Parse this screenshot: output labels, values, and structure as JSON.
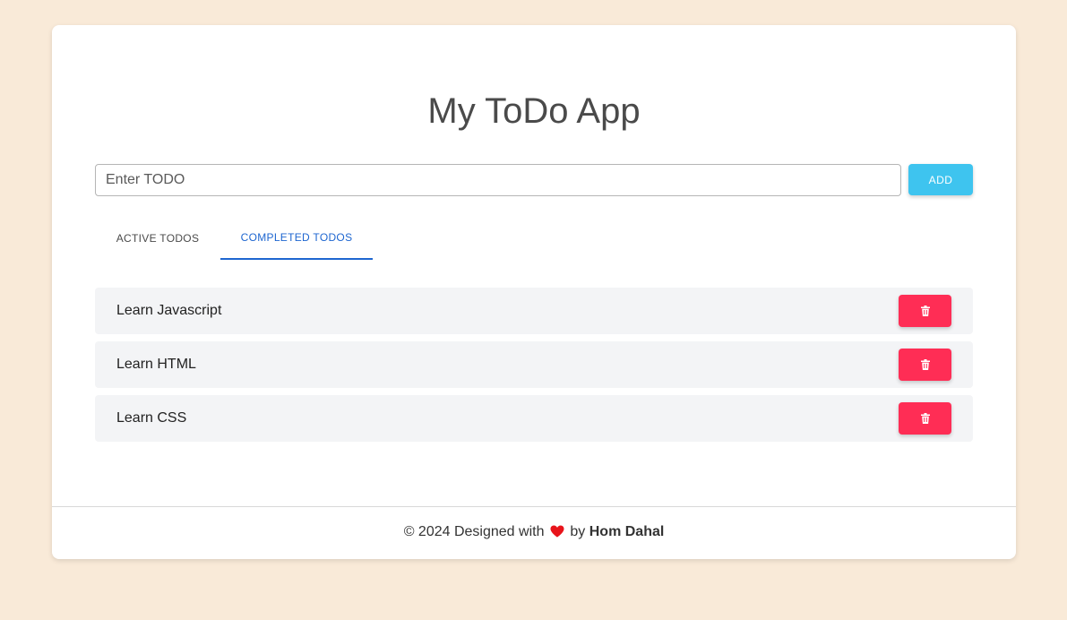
{
  "app": {
    "title": "My ToDo App"
  },
  "form": {
    "placeholder": "Enter TODO",
    "value": "",
    "add_label": "ADD"
  },
  "tabs": [
    {
      "label": "ACTIVE TODOS",
      "active": false
    },
    {
      "label": "COMPLETED TODOS",
      "active": true
    }
  ],
  "todos": [
    {
      "label": "Learn Javascript"
    },
    {
      "label": "Learn HTML"
    },
    {
      "label": "Learn CSS"
    }
  ],
  "footer": {
    "prefix": "© 2024 Designed with",
    "by": "by",
    "author": "Hom Dahal"
  },
  "colors": {
    "background": "#f9ead8",
    "add_button": "#3ec4ef",
    "delete_button": "#ff2d55",
    "active_tab": "#1e66d0",
    "heart": "#e8141b"
  },
  "icons": {
    "delete": "trash-icon",
    "heart": "heart-icon"
  }
}
